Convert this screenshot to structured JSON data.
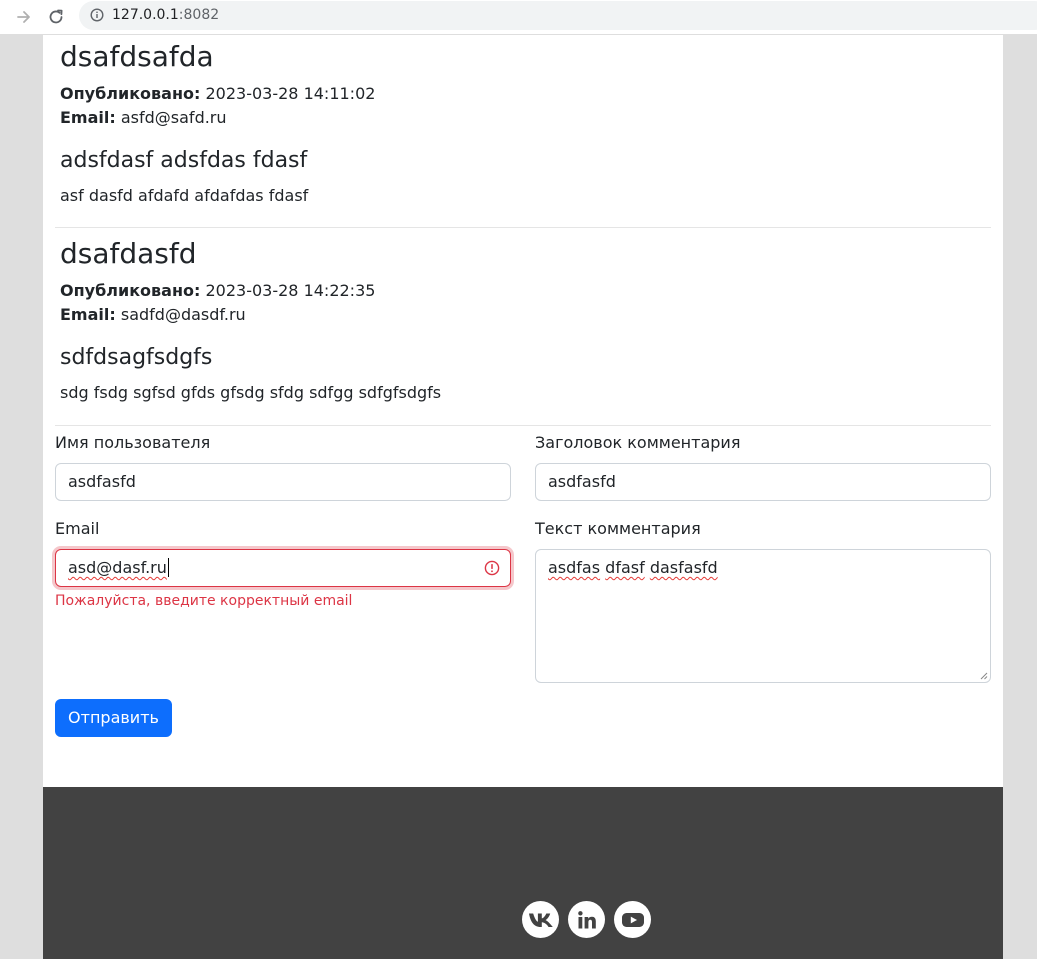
{
  "browser": {
    "url_host": "127.0.0.1",
    "url_port": ":8082"
  },
  "posts": [
    {
      "author": "dsafdsafda",
      "published_label": "Опубликовано:",
      "published": "2023-03-28 14:11:02",
      "email_label": "Email:",
      "email": "asfd@safd.ru",
      "title": "adsfdasf adsfdas fdasf",
      "body": "asf dasfd afdafd afdafdas fdasf"
    },
    {
      "author": "dsafdasfd",
      "published_label": "Опубликовано:",
      "published": "2023-03-28 14:22:35",
      "email_label": "Email:",
      "email": "sadfd@dasdf.ru",
      "title": "sdfdsagfsdgfs",
      "body": "sdg fsdg sgfsd gfds gfsdg sfdg sdfgg sdfgfsdgfs"
    }
  ],
  "form": {
    "username_label": "Имя пользователя",
    "username_value": "asdfasfd",
    "title_label": "Заголовок комментария",
    "title_value": "asdfasfd",
    "email_label": "Email",
    "email_value": "asd@dasf.ru",
    "email_error": "Пожалуйста, введите корректный email",
    "text_label": "Текст комментария",
    "text_value_words": [
      "asdfas",
      "dfasf",
      "dasfasfd"
    ],
    "submit_label": "Отправить"
  },
  "footer": {
    "social_icons": [
      "vk-icon",
      "linkedin-icon",
      "youtube-icon"
    ]
  },
  "colors": {
    "primary": "#0d6efd",
    "danger": "#dc3545",
    "footer_bg": "#424242"
  }
}
